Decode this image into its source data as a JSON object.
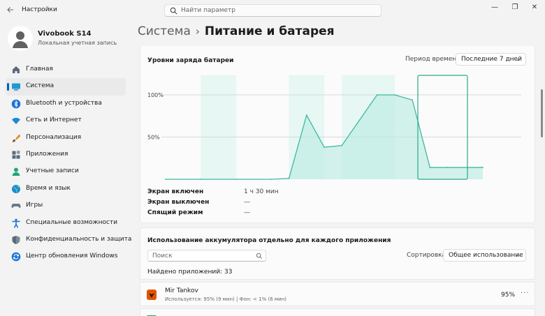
{
  "window": {
    "title": "Настройки",
    "search_placeholder": "Найти параметр",
    "minimize": "—",
    "maximize": "❐",
    "close": "✕"
  },
  "profile": {
    "name": "Vivobook S14",
    "subtitle": "Локальная учетная запись"
  },
  "sidebar": {
    "items": [
      {
        "label": "Главная",
        "icon": "home-icon"
      },
      {
        "label": "Система",
        "icon": "system-icon"
      },
      {
        "label": "Bluetooth и устройства",
        "icon": "bluetooth-icon"
      },
      {
        "label": "Сеть и Интернет",
        "icon": "wifi-icon"
      },
      {
        "label": "Персонализация",
        "icon": "brush-icon"
      },
      {
        "label": "Приложения",
        "icon": "apps-icon"
      },
      {
        "label": "Учетные записи",
        "icon": "account-icon"
      },
      {
        "label": "Время и язык",
        "icon": "globe-icon"
      },
      {
        "label": "Игры",
        "icon": "gamepad-icon"
      },
      {
        "label": "Специальные возможности",
        "icon": "accessibility-icon"
      },
      {
        "label": "Конфиденциальность и защита",
        "icon": "shield-icon"
      },
      {
        "label": "Центр обновления Windows",
        "icon": "update-icon"
      }
    ],
    "active_index": 1
  },
  "breadcrumb": {
    "parent": "Система",
    "separator": "›",
    "current": "Питание и батарея"
  },
  "battery_levels": {
    "title": "Уровни заряда батареи",
    "period_label": "Период времени:",
    "period_value": "Последние 7 дней"
  },
  "chart_data": {
    "type": "area",
    "title": "Уровни заряда батареи",
    "y_ticks": [
      "100%",
      "50%"
    ],
    "ylim": [
      0,
      100
    ],
    "grid": true,
    "x": [
      0,
      1,
      2,
      3,
      3.5,
      4,
      4.5,
      5,
      6,
      6.5,
      7,
      7.5,
      8,
      9
    ],
    "values": [
      0,
      0,
      0,
      0,
      1,
      76,
      38,
      40,
      100,
      100,
      94,
      14,
      14,
      14
    ],
    "highlighted_segment_index": 7
  },
  "screen_stats": [
    {
      "label": "Экран включен",
      "value": "1 ч 30 мин"
    },
    {
      "label": "Экран выключен",
      "value": "—"
    },
    {
      "label": "Спящий режим",
      "value": "—"
    }
  ],
  "usage": {
    "title": "Использование аккумулятора отдельно для каждого приложения",
    "search_placeholder": "Поиск",
    "sort_label": "Сортировка:",
    "sort_value": "Общее использование",
    "found_text": "Найдено приложений: 33",
    "apps": [
      {
        "name": "Mir Tankov",
        "detail": "Используется: 95% (9 мин) | Фон: < 1% (6 мин)",
        "percent": "95%"
      }
    ]
  },
  "colors": {
    "accent": "#005fb8",
    "chart_line": "#3fb9a0",
    "chart_fill": "#b7ebe1",
    "chart_band": "#e6f7f4"
  }
}
